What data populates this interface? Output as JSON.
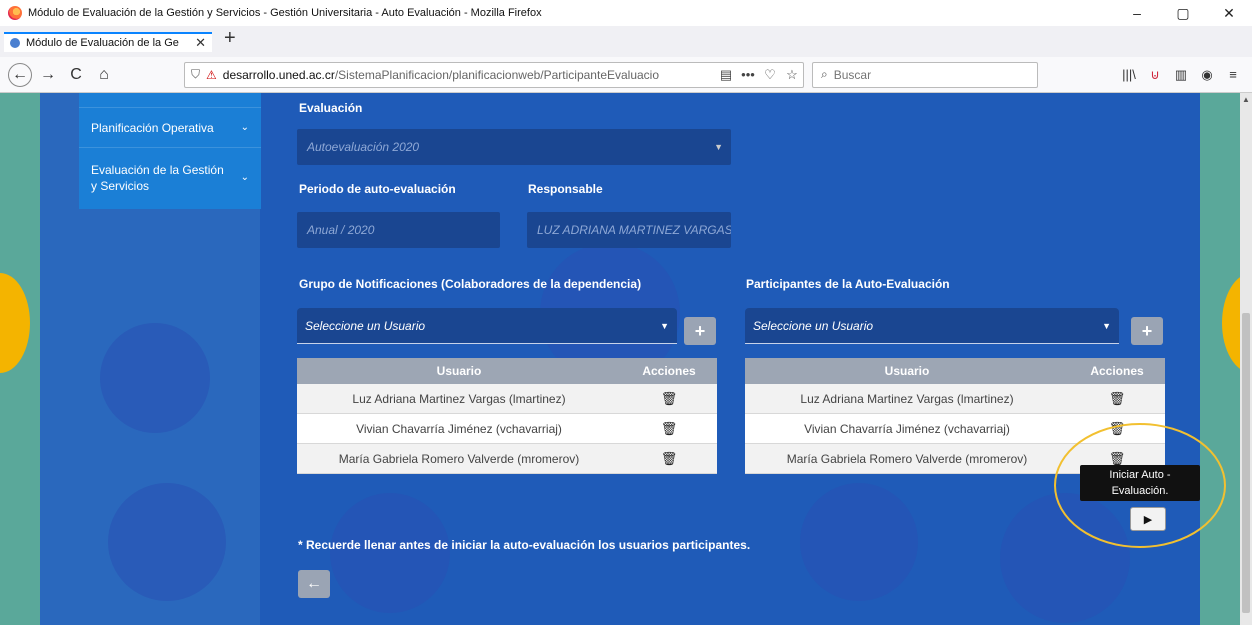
{
  "window": {
    "title": "Módulo de Evaluación de la Gestión y Servicios - Gestión Universitaria - Auto Evaluación - Mozilla Firefox",
    "minimize": "–",
    "maximize": "▢",
    "close": "✕"
  },
  "tab": {
    "label": "Módulo de Evaluación de la Ge",
    "close": "✕",
    "new": "+"
  },
  "nav": {
    "back": "←",
    "forward": "→",
    "reload": "C",
    "home": "⌂",
    "url_domain": "desarrollo.uned.ac.cr",
    "url_path": "/SistemaPlanificacion/planificacionweb/ParticipanteEvaluacio",
    "reader": "▤",
    "more": "•••",
    "pocket": "♡",
    "bookmark": "☆",
    "search_placeholder": "Buscar",
    "library": "|||\\",
    "shield2": "⊍",
    "sidebar": "▥",
    "account": "◉",
    "menu": "≡"
  },
  "sidebar": {
    "items": [
      {
        "label": "Planificación Operativa",
        "chev": "⌄"
      },
      {
        "label": "Evaluación de la Gestión y Servicios",
        "chev": "⌄"
      }
    ]
  },
  "form": {
    "evaluacion_label": "Evaluación",
    "evaluacion_value": "Autoevaluación 2020",
    "periodo_label": "Periodo de auto-evaluación",
    "periodo_value": "Anual / 2020",
    "responsable_label": "Responsable",
    "responsable_value": "LUZ ADRIANA MARTINEZ VARGAS"
  },
  "notificaciones": {
    "title": "Grupo de Notificaciones (Colaboradores de la dependencia)",
    "select_value": "Seleccione un Usuario",
    "add": "+",
    "columns": [
      "Usuario",
      "Acciones"
    ],
    "rows": [
      "Luz Adriana Martinez Vargas (lmartinez)",
      "Vivian Chavarría Jiménez (vchavarriaj)",
      "María Gabriela Romero Valverde (mromerov)"
    ]
  },
  "participantes": {
    "title": "Participantes de la Auto-Evaluación",
    "select_value": "Seleccione un Usuario",
    "add": "+",
    "columns": [
      "Usuario",
      "Acciones"
    ],
    "rows": [
      "Luz Adriana Martinez Vargas (lmartinez)",
      "Vivian Chavarría Jiménez (vchavarriaj)",
      "María Gabriela Romero Valverde (mromerov)"
    ]
  },
  "trash_icon": "🗑",
  "tooltip": "Iniciar Auto - Evaluación.",
  "play": "▶",
  "note": "* Recuerde llenar antes de iniciar la auto-evaluación los usuarios participantes.",
  "back_button": "←",
  "colors": {
    "page_bg": "#1f5bb8",
    "sidebar": "#1b7fd6",
    "table_header": "#9da6b4",
    "highlight": "#f2c030"
  }
}
